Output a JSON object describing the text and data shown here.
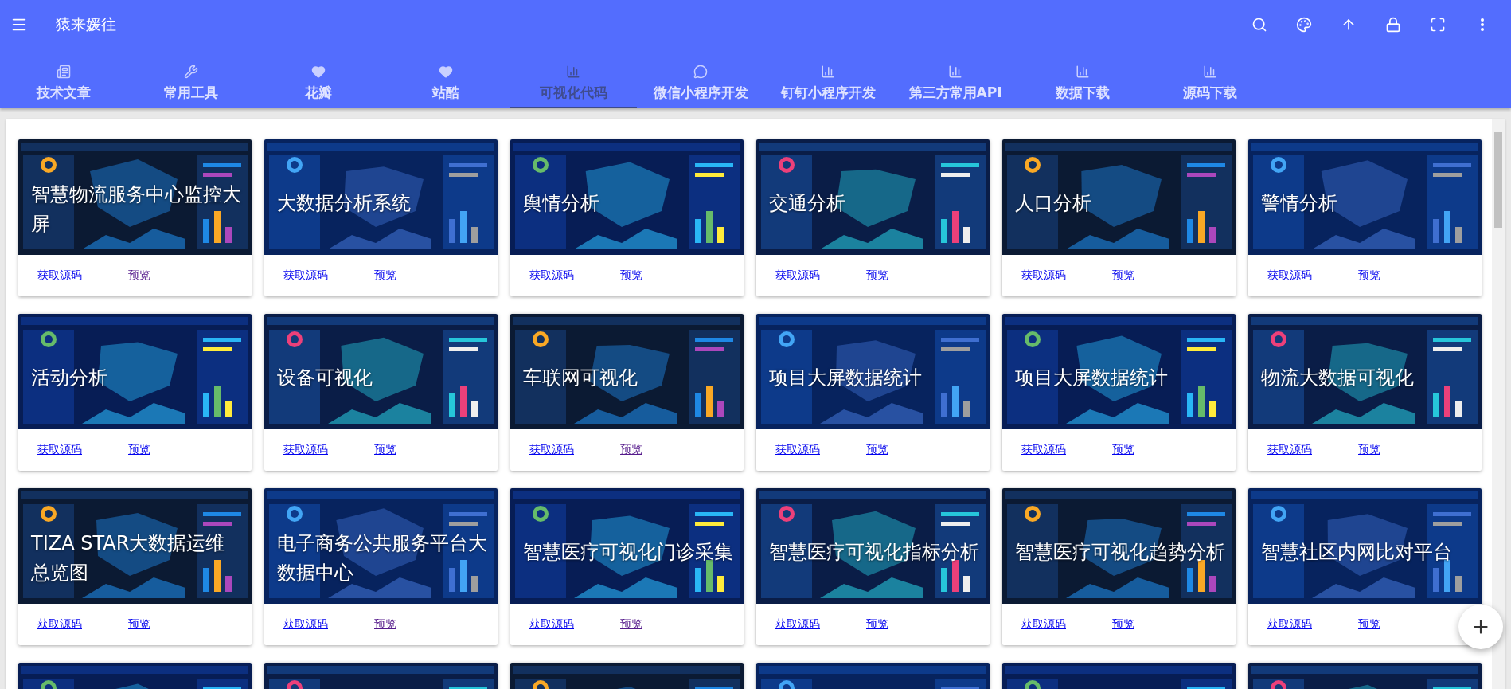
{
  "app_bar": {
    "title": "猿来媛往"
  },
  "tabs": [
    {
      "label": "技术文章",
      "selected": false
    },
    {
      "label": "常用工具",
      "selected": false
    },
    {
      "label": "花瓣",
      "selected": false
    },
    {
      "label": "站酷",
      "selected": false
    },
    {
      "label": "可视化代码",
      "selected": true
    },
    {
      "label": "微信小程序开发",
      "selected": false
    },
    {
      "label": "钉钉小程序开发",
      "selected": false
    },
    {
      "label": "第三方常用API",
      "selected": false
    },
    {
      "label": "数据下载",
      "selected": false
    },
    {
      "label": "源码下载",
      "selected": false
    }
  ],
  "cards": [
    {
      "kind": "card",
      "title": "智慧物流服务中心监控大屏",
      "source_link": "获取源码",
      "preview_link": {
        "text": "预览",
        "visited": true
      }
    },
    {
      "kind": "card",
      "title": "大数据分析系统",
      "source_link": "获取源码",
      "preview_link": {
        "text": "预览",
        "visited": false
      }
    },
    {
      "kind": "card",
      "title": "舆情分析",
      "source_link": "获取源码",
      "preview_link": {
        "text": "预览",
        "visited": false
      }
    },
    {
      "kind": "card",
      "title": "交通分析",
      "source_link": "获取源码",
      "preview_link": {
        "text": "预览",
        "visited": false
      }
    },
    {
      "kind": "card",
      "title": "人口分析",
      "source_link": "获取源码",
      "preview_link": {
        "text": "预览",
        "visited": false
      }
    },
    {
      "kind": "card",
      "title": "警情分析",
      "source_link": "获取源码",
      "preview_link": {
        "text": "预览",
        "visited": false
      }
    },
    {
      "kind": "card",
      "title": "活动分析",
      "source_link": "获取源码",
      "preview_link": {
        "text": "预览",
        "visited": false
      }
    },
    {
      "kind": "card",
      "title": "设备可视化",
      "source_link": "获取源码",
      "preview_link": {
        "text": "预览",
        "visited": false
      }
    },
    {
      "kind": "card",
      "title": "车联网可视化",
      "source_link": "获取源码",
      "preview_link": {
        "text": "预览",
        "visited": true
      }
    },
    {
      "kind": "card",
      "title": "项目大屏数据统计",
      "source_link": "获取源码",
      "preview_link": {
        "text": "预览",
        "visited": false
      }
    },
    {
      "kind": "card",
      "title": "项目大屏数据统计",
      "source_link": "获取源码",
      "preview_link": {
        "text": "预览",
        "visited": false
      }
    },
    {
      "kind": "card",
      "title": "物流大数据可视化",
      "source_link": "获取源码",
      "preview_link": {
        "text": "预览",
        "visited": false
      }
    },
    {
      "kind": "card",
      "title": "TIZA STAR大数据运维总览图",
      "source_link": "获取源码",
      "preview_link": {
        "text": "预览",
        "visited": false
      }
    },
    {
      "kind": "card",
      "title": "电子商务公共服务平台大数据中心",
      "source_link": "获取源码",
      "preview_link": {
        "text": "预览",
        "visited": true
      }
    },
    {
      "kind": "card",
      "title": "智慧医疗可视化门诊采集",
      "source_link": "获取源码",
      "preview_link": {
        "text": "预览",
        "visited": true
      }
    },
    {
      "kind": "card",
      "title": "智慧医疗可视化指标分析",
      "source_link": "获取源码",
      "preview_link": {
        "text": "预览",
        "visited": false
      }
    },
    {
      "kind": "card",
      "title": "智慧医疗可视化趋势分析",
      "source_link": "获取源码",
      "preview_link": {
        "text": "预览",
        "visited": false
      }
    },
    {
      "kind": "card",
      "title": "智慧社区内网比对平台",
      "source_link": "获取源码",
      "preview_link": {
        "text": "预览",
        "visited": false
      }
    },
    {
      "kind": "picture"
    },
    {
      "kind": "picture"
    },
    {
      "kind": "picture"
    },
    {
      "kind": "picture"
    },
    {
      "kind": "picture"
    },
    {
      "kind": "picture"
    }
  ]
}
